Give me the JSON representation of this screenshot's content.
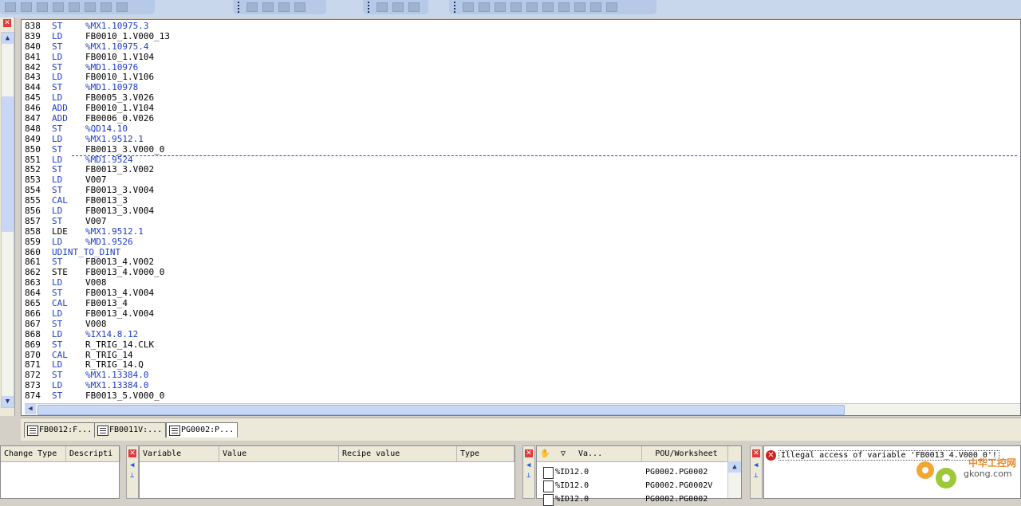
{
  "code_lines": [
    {
      "n": "838",
      "op": "ST",
      "arg": "%MX1.10975.3"
    },
    {
      "n": "839",
      "op": "LD",
      "arg": "FB0010_1.V000_13"
    },
    {
      "n": "840",
      "op": "ST",
      "arg": "%MX1.10975.4"
    },
    {
      "n": "841",
      "op": "LD",
      "arg": "FB0010_1.V104"
    },
    {
      "n": "842",
      "op": "ST",
      "arg": "%MD1.10976"
    },
    {
      "n": "843",
      "op": "LD",
      "arg": "FB0010_1.V106"
    },
    {
      "n": "844",
      "op": "ST",
      "arg": "%MD1.10978"
    },
    {
      "n": "845",
      "op": "LD",
      "arg": "FB0005_3.V026"
    },
    {
      "n": "846",
      "op": "ADD",
      "arg": "FB0010_1.V104"
    },
    {
      "n": "847",
      "op": "ADD",
      "arg": "FB0006_0.V026"
    },
    {
      "n": "848",
      "op": "ST",
      "arg": "%QD14.10"
    },
    {
      "n": "849",
      "op": "LD",
      "arg": "%MX1.9512.1"
    },
    {
      "n": "850",
      "op": "ST",
      "arg": "FB0013_3.V000_0"
    },
    {
      "n": "851",
      "op": "LD",
      "arg": "%MD1.9524"
    },
    {
      "n": "852",
      "op": "ST",
      "arg": "FB0013_3.V002"
    },
    {
      "n": "853",
      "op": "LD",
      "arg": "V007"
    },
    {
      "n": "854",
      "op": "ST",
      "arg": "FB0013_3.V004"
    },
    {
      "n": "855",
      "op": "CAL",
      "arg": "FB0013_3"
    },
    {
      "n": "856",
      "op": "LD",
      "arg": "FB0013_3.V004"
    },
    {
      "n": "857",
      "op": "ST",
      "arg": "V007"
    },
    {
      "n": "858",
      "op": "LDE",
      "arg": "%MX1.9512.1"
    },
    {
      "n": "859",
      "op": "LD",
      "arg": "%MD1.9526"
    },
    {
      "n": "860",
      "op": "UDINT_TO_DINT",
      "arg": ""
    },
    {
      "n": "861",
      "op": "ST",
      "arg": "FB0013_4.V002"
    },
    {
      "n": "862",
      "op": "STE",
      "arg": "FB0013_4.V000_0"
    },
    {
      "n": "863",
      "op": "LD",
      "arg": "V008"
    },
    {
      "n": "864",
      "op": "ST",
      "arg": "FB0013_4.V004"
    },
    {
      "n": "865",
      "op": "CAL",
      "arg": "FB0013_4"
    },
    {
      "n": "866",
      "op": "LD",
      "arg": "FB0013_4.V004"
    },
    {
      "n": "867",
      "op": "ST",
      "arg": "V008"
    },
    {
      "n": "868",
      "op": "LD",
      "arg": "%IX14.8.12"
    },
    {
      "n": "869",
      "op": "ST",
      "arg": "R_TRIG_14.CLK"
    },
    {
      "n": "870",
      "op": "CAL",
      "arg": "R_TRIG_14"
    },
    {
      "n": "871",
      "op": "LD",
      "arg": "R_TRIG_14.Q"
    },
    {
      "n": "872",
      "op": "ST",
      "arg": "%MX1.13384.0"
    },
    {
      "n": "873",
      "op": "LD",
      "arg": "%MX1.13384.0"
    },
    {
      "n": "874",
      "op": "ST",
      "arg": "FB0013_5.V000_0"
    }
  ],
  "tabs": [
    {
      "label": "FB0012:F..."
    },
    {
      "label": "FB0011V:..."
    },
    {
      "label": "PG0002:P..."
    }
  ],
  "change_panel": {
    "col_change_type": "Change Type",
    "col_description": "Descripti"
  },
  "recipe_panel": {
    "col_variable": "Variable",
    "col_value": "Value",
    "col_recipe_value": "Recipe value",
    "col_type": "Type"
  },
  "xref_panel": {
    "col_va": "Va...",
    "col_pou": "POU/Worksheet",
    "rows": [
      {
        "var": "%ID12.0",
        "pou": "PG0002.PG0002"
      },
      {
        "var": "%ID12.0",
        "pou": "PG0002.PG0002V"
      },
      {
        "var": "%ID12.0",
        "pou": "PG0002.PG0002"
      }
    ]
  },
  "error_panel": {
    "message": "Illegal access of variable 'FB0013_4.V000_0'!"
  },
  "watermark": {
    "text": "中华工控网",
    "domain": "gkong.com"
  },
  "colors": {
    "keyword": "#1e3cc8",
    "error": "#d42020",
    "tab_active": "#ffffff"
  }
}
